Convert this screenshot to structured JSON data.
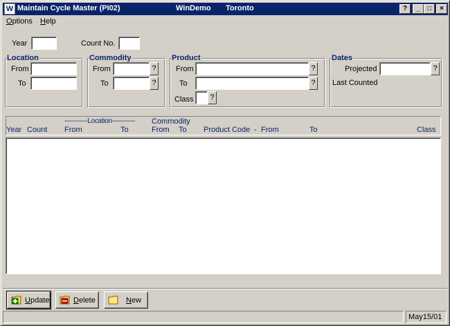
{
  "window": {
    "icon_letter": "W",
    "title": "Maintain Cycle Master (PI02)",
    "app_name": "WinDemo",
    "location_name": "Toronto",
    "help_btn": "?",
    "min_btn": "_",
    "max_btn": "□",
    "close_btn": "×"
  },
  "menu": {
    "options": "Options",
    "help": "Help"
  },
  "form": {
    "year_label": "Year",
    "year_value": "",
    "count_no_label": "Count No.",
    "count_no_value": ""
  },
  "location_group": {
    "title": "Location",
    "from_label": "From",
    "from_value": "",
    "to_label": "To",
    "to_value": ""
  },
  "commodity_group": {
    "title": "Commodity",
    "from_label": "From",
    "from_value": "",
    "to_label": "To",
    "to_value": ""
  },
  "product_group": {
    "title": "Product",
    "from_label": "From",
    "from_value": "",
    "to_label": "To",
    "to_value": "",
    "class_label": "Class",
    "class_value": ""
  },
  "dates_group": {
    "title": "Dates",
    "projected_label": "Projected",
    "projected_value": "",
    "last_counted_label": "Last Counted"
  },
  "lookup_glyph": "?",
  "list_header": {
    "location_span": "-----------Location-----------",
    "commodity_span": "Commodity",
    "columns": [
      "Year",
      "Count",
      "From",
      "To",
      "From",
      "To",
      "Product Code",
      "-",
      "From",
      "To",
      "Class"
    ]
  },
  "list_rows": [],
  "buttons": {
    "update": {
      "mnemonic": "U",
      "rest": "pdate",
      "icon": "add-folder-icon"
    },
    "delete": {
      "mnemonic": "D",
      "rest": "elete",
      "icon": "delete-folder-icon"
    },
    "new": {
      "mnemonic": "N",
      "rest": "ew",
      "icon": "folder-icon"
    }
  },
  "status": {
    "date": "May15/01"
  }
}
